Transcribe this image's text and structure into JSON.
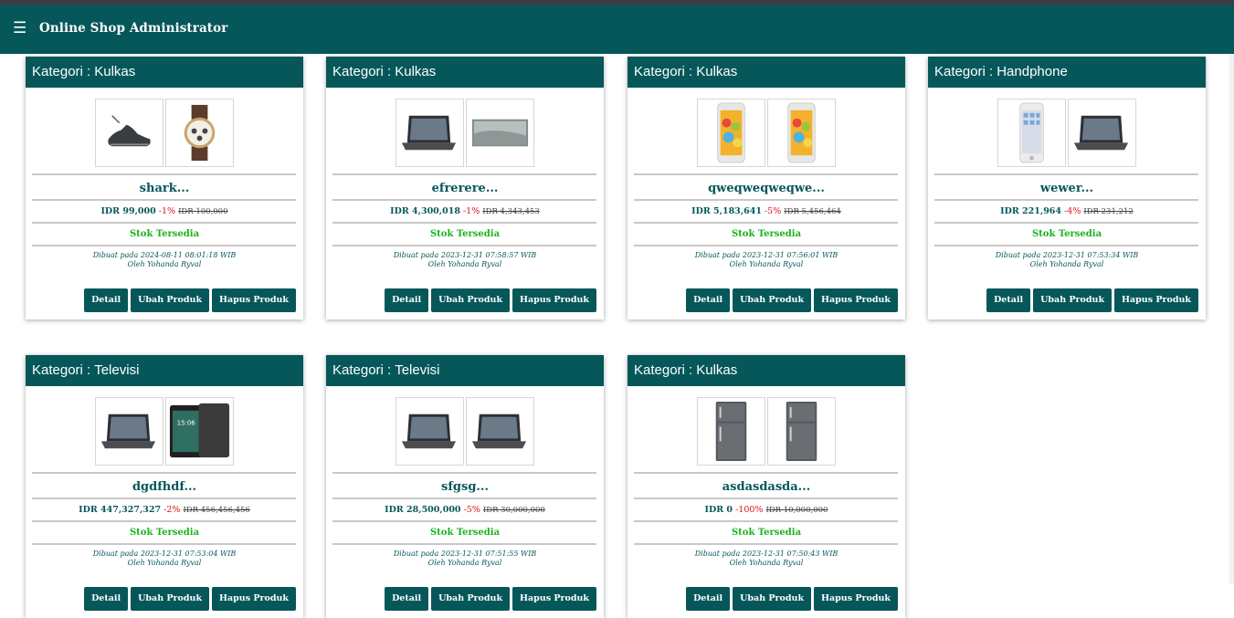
{
  "navbar": {
    "menu_icon": "☰",
    "title": "Online Shop Administrator"
  },
  "labels": {
    "category_prefix": "Kategori :",
    "stock": "Stok Tersedia",
    "detail": "Detail",
    "edit": "Ubah Produk",
    "delete": "Hapus Produk"
  },
  "colors": {
    "primary": "#06575a",
    "discount": "#e01010",
    "stock": "#19b31e"
  },
  "products": [
    {
      "category": "Kulkas",
      "name": "shark...",
      "price": "IDR 99,000",
      "discount": "-1%",
      "old_price": "IDR 100,000",
      "created": "Dibuat pada 2024-08-11 08:01:18 WIB",
      "author": "Oleh Yohanda Ryval",
      "images": [
        "sneaker-image",
        "wristwatch-image"
      ]
    },
    {
      "category": "Kulkas",
      "name": "efrerere...",
      "price": "IDR 4,300,018",
      "discount": "-1%",
      "old_price": "IDR 4,343,453",
      "created": "Dibuat pada 2023-12-31 07:58:57 WIB",
      "author": "Oleh Yohanda Ryval",
      "images": [
        "laptop-image",
        "television-image"
      ]
    },
    {
      "category": "Kulkas",
      "name": "qweqweqweqwe...",
      "price": "IDR 5,183,641",
      "discount": "-5%",
      "old_price": "IDR 5,456,464",
      "created": "Dibuat pada 2023-12-31 07:56:01 WIB",
      "author": "Oleh Yohanda Ryval",
      "images": [
        "smartphone-image",
        "smartphone-image"
      ]
    },
    {
      "category": "Handphone",
      "name": "wewer...",
      "price": "IDR 221,964",
      "discount": "-4%",
      "old_price": "IDR 231,212",
      "created": "Dibuat pada 2023-12-31 07:53:34 WIB",
      "author": "Oleh Yohanda Ryval",
      "images": [
        "iphone-image",
        "laptop-image"
      ]
    },
    {
      "category": "Televisi",
      "name": "dgdfhdf...",
      "price": "IDR 447,327,327",
      "discount": "-2%",
      "old_price": "IDR 456,456,456",
      "created": "Dibuat pada 2023-12-31 07:53:04 WIB",
      "author": "Oleh Yohanda Ryval",
      "images": [
        "laptop-image",
        "tablet-image"
      ]
    },
    {
      "category": "Televisi",
      "name": "sfgsg...",
      "price": "IDR 28,500,000",
      "discount": "-5%",
      "old_price": "IDR 30,000,000",
      "created": "Dibuat pada 2023-12-31 07:51:55 WIB",
      "author": "Oleh Yohanda Ryval",
      "images": [
        "laptop-image",
        "laptop-image"
      ]
    },
    {
      "category": "Kulkas",
      "name": "asdasdasda...",
      "price": "IDR 0",
      "discount": "-100%",
      "old_price": "IDR 10,000,000",
      "created": "Dibuat pada 2023-12-31 07:50:43 WIB",
      "author": "Oleh Yohanda Ryval",
      "images": [
        "refrigerator-image",
        "refrigerator-image"
      ]
    }
  ]
}
